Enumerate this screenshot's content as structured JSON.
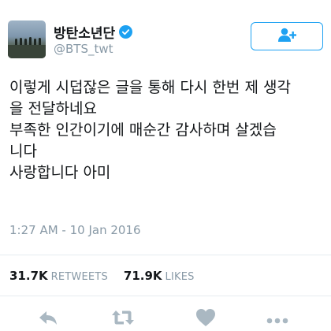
{
  "user": {
    "display_name": "방탄소년단",
    "handle": "@BTS_twt",
    "verified": true,
    "avatar_icon": "profile-photo"
  },
  "follow_button": {
    "icon": "add-user-icon"
  },
  "tweet": {
    "lines": [
      "이렇게 시덥잖은 글을 통해 다시 한번 제 생각",
      "을 전달하네요",
      "부족한 인간이기에 매순간 감사하며 살겠습",
      "니다",
      "사랑합니다 아미"
    ],
    "timestamp": "1:27 AM - 10 Jan 2016"
  },
  "stats": {
    "retweets_count": "31.7K",
    "retweets_label": "RETWEETS",
    "likes_count": "71.9K",
    "likes_label": "LIKES"
  },
  "actions": [
    "reply-icon",
    "retweet-icon",
    "like-icon",
    "more-icon"
  ],
  "colors": {
    "accent": "#1da1f2",
    "muted": "#8899a6",
    "text": "#14171a",
    "icon": "#aab8c2"
  }
}
